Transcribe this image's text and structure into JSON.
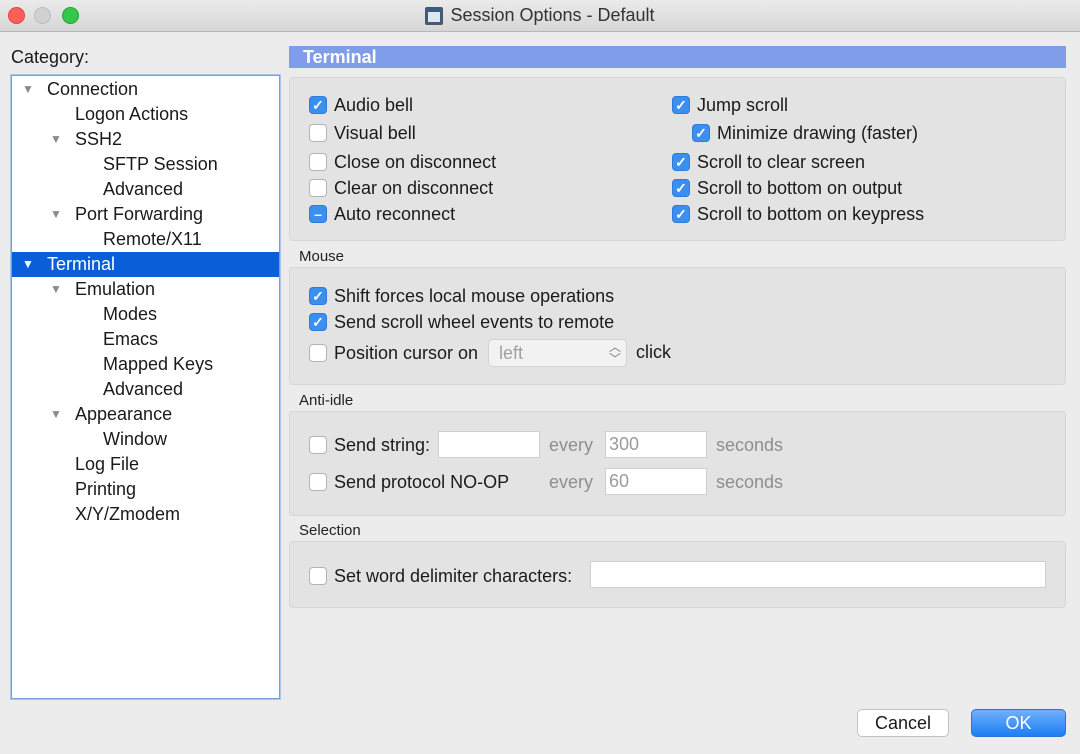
{
  "window": {
    "title": "Session Options - Default",
    "controls": [
      "close",
      "minimize",
      "zoom"
    ]
  },
  "category": {
    "label": "Category:",
    "items": [
      {
        "label": "Connection",
        "expanded": true
      },
      {
        "label": "Logon Actions"
      },
      {
        "label": "SSH2",
        "expanded": true
      },
      {
        "label": "SFTP Session"
      },
      {
        "label": "Advanced"
      },
      {
        "label": "Port Forwarding",
        "expanded": true
      },
      {
        "label": "Remote/X11"
      },
      {
        "label": "Terminal",
        "expanded": true,
        "selected": true
      },
      {
        "label": "Emulation",
        "expanded": true
      },
      {
        "label": "Modes"
      },
      {
        "label": "Emacs"
      },
      {
        "label": "Mapped Keys"
      },
      {
        "label": "Advanced"
      },
      {
        "label": "Appearance",
        "expanded": true
      },
      {
        "label": "Window"
      },
      {
        "label": "Log File"
      },
      {
        "label": "Printing"
      },
      {
        "label": "X/Y/Zmodem"
      }
    ]
  },
  "section": {
    "title": "Terminal"
  },
  "terminal": {
    "options": [
      {
        "label": "Audio bell",
        "state": "checked"
      },
      {
        "label": "Visual bell",
        "state": "unchecked"
      },
      {
        "label": "Close on disconnect",
        "state": "unchecked"
      },
      {
        "label": "Clear on disconnect",
        "state": "unchecked"
      },
      {
        "label": "Auto reconnect",
        "state": "mixed"
      },
      {
        "label": "Jump scroll",
        "state": "checked"
      },
      {
        "label": "Minimize drawing (faster)",
        "state": "checked"
      },
      {
        "label": "Scroll to clear screen",
        "state": "checked"
      },
      {
        "label": "Scroll to bottom on output",
        "state": "checked"
      },
      {
        "label": "Scroll to bottom on keypress",
        "state": "checked"
      }
    ]
  },
  "mouse": {
    "label": "Mouse",
    "shift_forces": {
      "label": "Shift forces local mouse operations",
      "state": "checked"
    },
    "scroll_wheel": {
      "label": "Send scroll wheel events to remote",
      "state": "checked"
    },
    "position_cursor": {
      "label": "Position cursor on",
      "state": "unchecked",
      "select_value": "left",
      "suffix": "click"
    }
  },
  "anti_idle": {
    "label": "Anti-idle",
    "send_string": {
      "label": "Send string:",
      "state": "unchecked",
      "value": "",
      "every": "every",
      "interval": "300",
      "unit": "seconds"
    },
    "send_noop": {
      "label": "Send protocol NO-OP",
      "state": "unchecked",
      "every": "every",
      "interval": "60",
      "unit": "seconds"
    }
  },
  "selection": {
    "label": "Selection",
    "word_delim": {
      "label": "Set word delimiter characters:",
      "state": "unchecked",
      "value": ""
    }
  },
  "buttons": {
    "cancel": "Cancel",
    "ok": "OK"
  },
  "colors": {
    "selection": "#0a5fd8",
    "section_header": "#7f9de8",
    "checkbox": "#3b8ff0",
    "ok_button": "#1d7ef5"
  }
}
